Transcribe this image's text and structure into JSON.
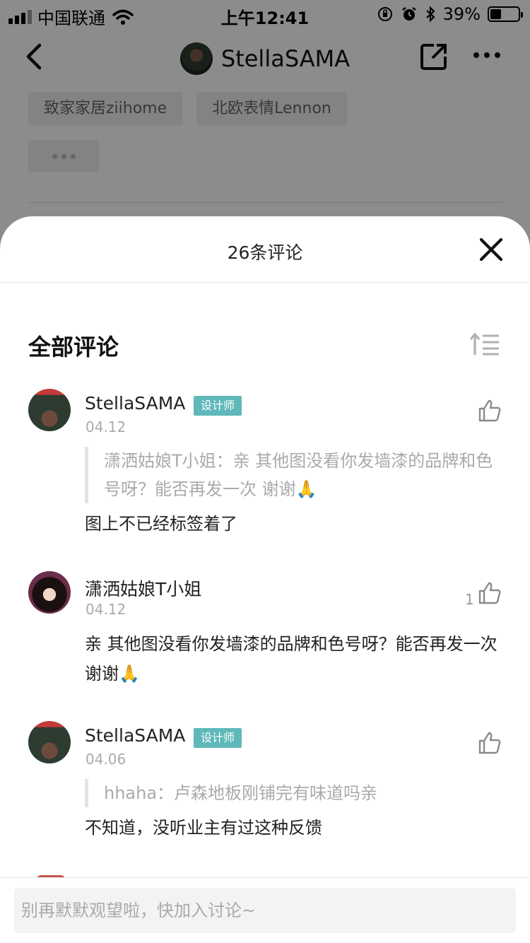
{
  "status_bar": {
    "carrier": "中国联通",
    "time": "上午12:41",
    "battery": "39%",
    "battery_level": 0.39
  },
  "nav": {
    "title": "StellaSAMA"
  },
  "background": {
    "tags": [
      "致家家居ziihome",
      "北欧表情Lennon"
    ]
  },
  "sheet": {
    "title": "26条评论",
    "section_heading": "全部评论"
  },
  "comments": [
    {
      "name": "StellaSAMA",
      "badge": "设计师",
      "date": "04.12",
      "quote": "潇洒姑娘T小姐：亲 其他图没看你发墙漆的品牌和色号呀？能否再发一次 谢谢🙏",
      "text": "图上不已经标签着了",
      "likes": ""
    },
    {
      "name": "潇洒姑娘T小姐",
      "badge": "",
      "date": "04.12",
      "quote": "",
      "text": "亲 其他图没看你发墙漆的品牌和色号呀？能否再发一次 谢谢🙏",
      "likes": "1"
    },
    {
      "name": "StellaSAMA",
      "badge": "设计师",
      "date": "04.06",
      "quote": "hhaha：卢森地板刚铺完有味道吗亲",
      "text": "不知道，没听业主有过这种反馈",
      "likes": ""
    }
  ],
  "footer": {
    "input_placeholder": "别再默默观望啦，快加入讨论~"
  },
  "colors": {
    "badge": "#5fb8b9",
    "overlay": "rgba(0,0,0,0.45)"
  }
}
